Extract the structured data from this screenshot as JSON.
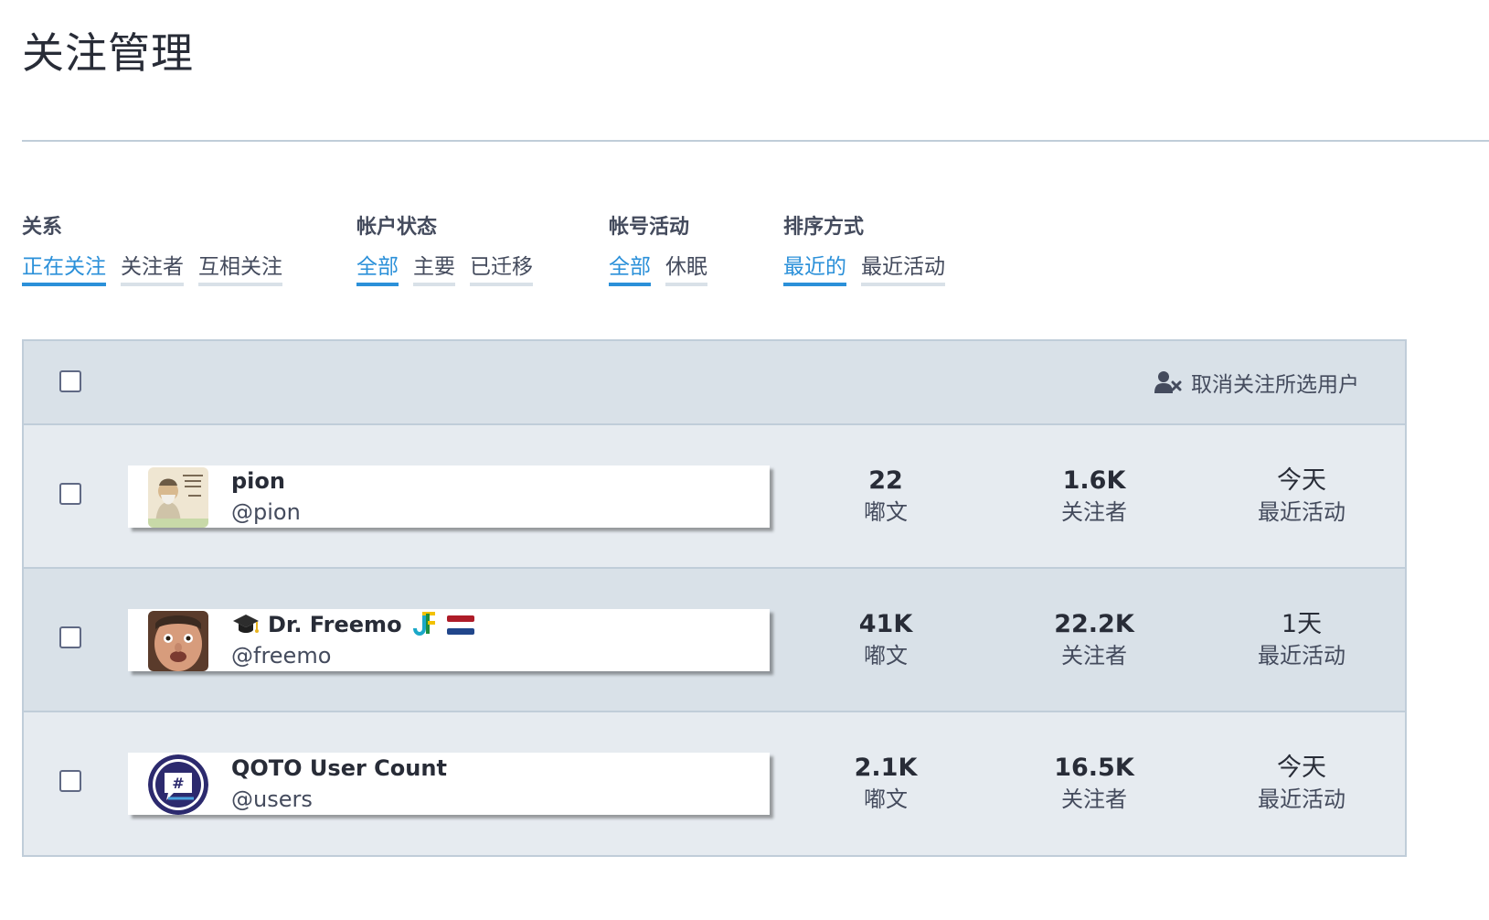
{
  "page": {
    "title": "关注管理"
  },
  "filters": [
    {
      "label": "关系",
      "options": [
        "正在关注",
        "关注者",
        "互相关注"
      ],
      "active": 0
    },
    {
      "label": "帐户状态",
      "options": [
        "全部",
        "主要",
        "已迁移"
      ],
      "active": 0
    },
    {
      "label": "帐号活动",
      "options": [
        "全部",
        "休眠"
      ],
      "active": 0
    },
    {
      "label": "排序方式",
      "options": [
        "最近的",
        "最近活动"
      ],
      "active": 0
    }
  ],
  "table": {
    "batch_action_label": "取消关注所选用户",
    "stat_labels": {
      "posts": "嘟文",
      "followers": "关注者",
      "activity": "最近活动"
    },
    "rows": [
      {
        "display_name": "pion",
        "handle": "@pion",
        "posts": "22",
        "followers": "1.6K",
        "last_active": "今天",
        "avatar": "confucius-quote-avatar"
      },
      {
        "display_name": "Dr. Freemo",
        "handle": "@freemo",
        "posts": "41K",
        "followers": "22.2K",
        "last_active": "1天",
        "avatar": "face-photo-avatar",
        "badges": [
          "graduation-cap-icon",
          "jf-logo-icon",
          "netherlands-flag-icon"
        ]
      },
      {
        "display_name": "QOTO User Count",
        "handle": "@users",
        "posts": "2.1K",
        "followers": "16.5K",
        "last_active": "今天",
        "avatar": "hashtag-chat-avatar"
      }
    ]
  },
  "colors": {
    "accent": "#2b90d9",
    "header_bg": "#d9e1e8",
    "row_bg": "#e6ebf0",
    "border": "#c0cdd9"
  }
}
